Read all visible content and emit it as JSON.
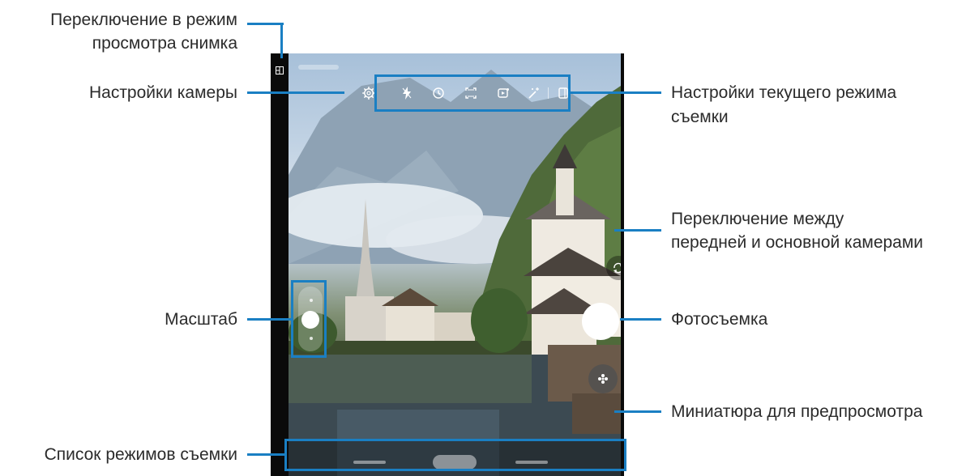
{
  "callouts": {
    "view_mode": [
      "Переключение в режим",
      "просмотра снимка"
    ],
    "camera_settings": "Настройки камеры",
    "zoom": "Масштаб",
    "modes_list": "Список режимов съемки",
    "mode_settings": [
      "Настройки текущего режима",
      "съемки"
    ],
    "switch_camera": [
      "Переключение между",
      "передней и основной камерами"
    ],
    "shutter": "Фотосъемка",
    "preview_thumbnail": "Миниатюра для предпросмотра"
  },
  "icons": {
    "view_mode": "view-mode-icon",
    "settings": "gear-icon",
    "flash": "flash-icon",
    "timer": "timer-icon",
    "ratio": "aspect-ratio-icon",
    "motion": "motion-photo-icon",
    "filters": "effects-icon",
    "switch": "switch-camera-icon",
    "thumbnail": "gallery-thumbnail-icon"
  },
  "colors": {
    "callout_line": "#1a7fc3",
    "highlight_box": "#1a7fc3"
  }
}
